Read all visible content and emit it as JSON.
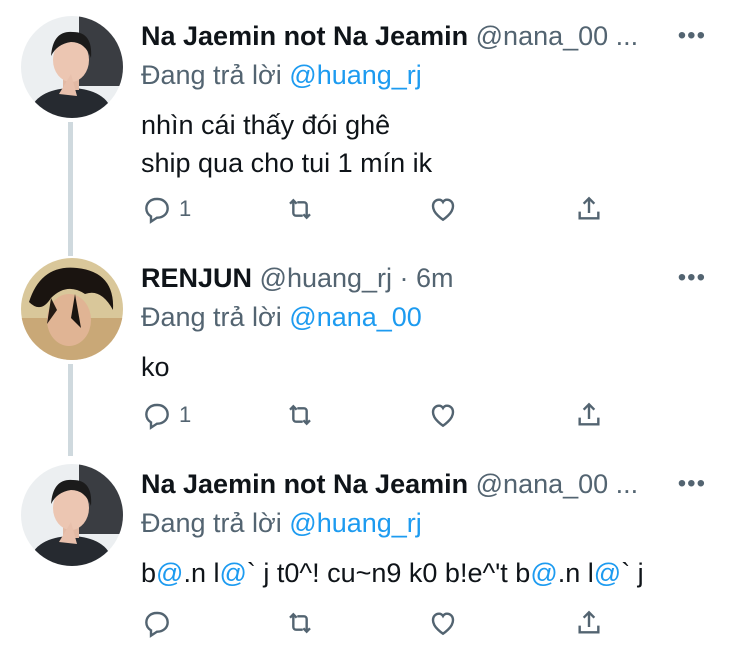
{
  "tweets": [
    {
      "name": "Na Jaemin not Na Jeamin",
      "handle": "@nana_00 ...",
      "more_icon": "more-horizontal-icon",
      "reply_prefix": "Đang trả lời",
      "reply_mention": "@huang_rj",
      "body_lines": [
        "nhìn cái thấy đói ghê",
        "ship qua cho tui 1 mín ik"
      ],
      "reply_count": "1"
    },
    {
      "name": "RENJUN",
      "handle": "@huang_rj · 6m",
      "more_icon": "more-horizontal-icon",
      "reply_prefix": "Đang trả lời",
      "reply_mention": "@nana_00",
      "body_lines": [
        "ko"
      ],
      "reply_count": "1"
    },
    {
      "name": "Na Jaemin not Na Jeamin",
      "handle": "@nana_00 ...",
      "more_icon": "more-horizontal-icon",
      "reply_prefix": "Đang trả lời",
      "reply_mention": "@huang_rj",
      "body_parts": [
        "b",
        "@",
        ".n l",
        "@",
        "` j t0^! cu~n9 k0 b!e^'t b",
        "@",
        ".n l",
        "@",
        "` j"
      ],
      "reply_count": ""
    }
  ],
  "icons": [
    "reply-icon",
    "retweet-icon",
    "like-icon",
    "share-icon"
  ],
  "colors": {
    "accent": "#1d9bf0",
    "secondary_text": "#536471",
    "thread_line": "#cfd9de"
  }
}
